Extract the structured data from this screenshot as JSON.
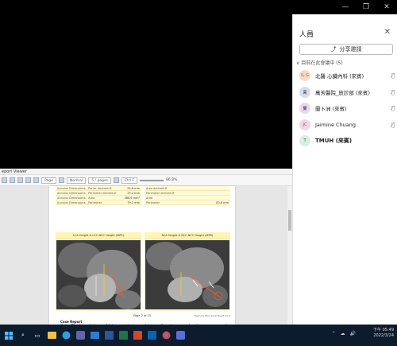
{
  "window_controls": {
    "minimize": "—",
    "restore": "❐",
    "close": "✕"
  },
  "panel": {
    "title": "人員",
    "close": "✕",
    "share_label": "分享邀請",
    "section_label": "目前在此會議中 (5)",
    "people": [
      {
        "initials": "IL G",
        "name": "北醫 心臟內科 (來賓)",
        "avatar_color": "#f6dcc5",
        "muted": true
      },
      {
        "initials": "萬",
        "name": "萬芳醫院_放診部 (來賓)",
        "avatar_color": "#d6ddef",
        "muted": true
      },
      {
        "initials": "蘭",
        "name": "蘭卜洲 (來賓)",
        "avatar_color": "#e4d9ee",
        "muted": true
      },
      {
        "initials": "JC",
        "name": "Jaimine Chuang",
        "avatar_color": "#f2d7e6",
        "muted": true
      },
      {
        "initials": "T",
        "name": "TMUH (來賓)",
        "avatar_color": "#d8eee4",
        "muted": false
      }
    ]
  },
  "viewer": {
    "title": "eport Viewer",
    "toolbar": {
      "page_field": "Page",
      "zoom_field": "Normal",
      "pages_field": "5 / pages",
      "find_field": "Ctrl F",
      "zoom_value": "86.8%"
    },
    "left_table": [
      {
        "label": "Annulus Dimensions - Perim. derived Ø",
        "value": "24.6 mm"
      },
      {
        "label": "Annulus Dimensions - Perimeter derived Ø",
        "value": "25.2 mm"
      },
      {
        "label": "Annulus Dimensions - Area",
        "value": "486.6 mm²"
      },
      {
        "label": "Annulus Dimensions - Perimeter",
        "value": "79.2 mm"
      }
    ],
    "right_table": [
      {
        "label": "Area derived Ø",
        "value": ""
      },
      {
        "label": "Perimeter derived Ø",
        "value": ""
      },
      {
        "label": "Area",
        "value": ""
      },
      {
        "label": "Perimeter",
        "value": "83.8 mm"
      }
    ],
    "fig_left_title": "LCA Height & LCC-NCC Height (MPR)",
    "fig_right_title": "RCA Height & RCC-NCC Height (MPR)",
    "page_label": "Page 2 of 15",
    "page_right": "Memory Structural Heart V1.5",
    "case_title": "Case Report",
    "case_note_line1": "Note: The intended use of this report is to provide an adjunctive case planning resource and should not be used for",
    "case_note_line2": "diagnostic purposes."
  },
  "taskbar": {
    "time": "下午 05:49",
    "date": "2022/3/24",
    "icons": [
      "windows-logo-icon",
      "search-icon",
      "task-view-icon",
      "file-explorer-icon",
      "edge-icon",
      "teams-icon",
      "mail-icon",
      "word-icon",
      "excel-icon",
      "powerpoint-icon",
      "outlook-icon",
      "chrome-icon",
      "app-icon"
    ]
  }
}
